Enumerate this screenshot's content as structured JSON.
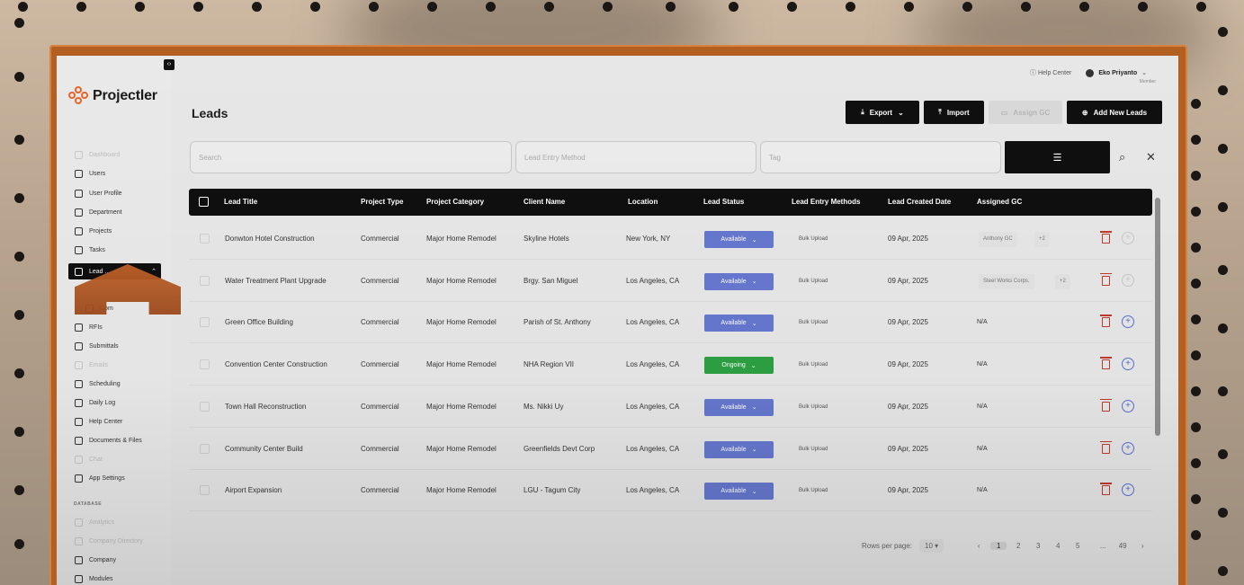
{
  "app": {
    "name": "Projectler"
  },
  "header": {
    "help": "Help Center",
    "user_name": "Eko Priyanto",
    "user_role": "Member"
  },
  "page": {
    "title": "Leads"
  },
  "actions": {
    "export": "Export",
    "import": "Import",
    "assign_gc": "Assign GC",
    "add_new": "Add New Leads"
  },
  "filters": {
    "search_placeholder": "Search",
    "entry_method_placeholder": "Lead Entry Method",
    "tag_placeholder": "Tag"
  },
  "sidebar": {
    "items": [
      {
        "label": "Dashboard",
        "icon": "dashboard-icon",
        "faded": true
      },
      {
        "label": "Users",
        "icon": "users-icon",
        "faded": false
      },
      {
        "label": "User Profile",
        "icon": "user-profile-icon",
        "faded": false
      },
      {
        "label": "Department",
        "icon": "department-icon",
        "faded": false
      },
      {
        "label": "Projects",
        "icon": "projects-icon",
        "faded": false
      },
      {
        "label": "Tasks",
        "icon": "tasks-icon",
        "faded": false
      },
      {
        "label": "Lead ...",
        "icon": "leads-icon",
        "active": true
      },
      {
        "label": "Com",
        "icon": "sub-icon",
        "faded": false
      },
      {
        "label": "RFIs",
        "icon": "rfis-icon",
        "faded": false
      },
      {
        "label": "Submittals",
        "icon": "submittals-icon",
        "faded": false
      },
      {
        "label": "Emails",
        "icon": "emails-icon",
        "faded": true
      },
      {
        "label": "Scheduling",
        "icon": "scheduling-icon",
        "faded": false
      },
      {
        "label": "Daily Log",
        "icon": "daily-log-icon",
        "faded": false
      },
      {
        "label": "Help Center",
        "icon": "help-icon",
        "faded": false
      },
      {
        "label": "Documents & Files",
        "icon": "documents-icon",
        "faded": false
      },
      {
        "label": "Chat",
        "icon": "chat-icon",
        "faded": true
      },
      {
        "label": "App Settings",
        "icon": "settings-icon",
        "faded": false
      }
    ],
    "section_label": "DATABASE",
    "database_items": [
      {
        "label": "Analytics",
        "faded": true
      },
      {
        "label": "Company Directory",
        "faded": true
      },
      {
        "label": "Company",
        "faded": false
      },
      {
        "label": "Modules",
        "faded": false
      }
    ]
  },
  "table": {
    "headers": [
      "Lead Title",
      "Project Type",
      "Project Category",
      "Client Name",
      "Location",
      "Lead Status",
      "Lead Entry Methods",
      "Lead Created Date",
      "Assigned GC"
    ],
    "rows": [
      {
        "title": "Donwton Hotel Construction",
        "type": "Commercial",
        "category": "Major Home Remodel",
        "client": "Skyline Hotels",
        "location": "New York, NY",
        "status": "Available",
        "entry": "Bulk Upload",
        "date": "09 Apr, 2025",
        "gc": "Anthony GC",
        "gc_more": "+2"
      },
      {
        "title": "Water Treatment Plant Upgrade",
        "type": "Commercial",
        "category": "Major Home Remodel",
        "client": "Brgy. San Miguel",
        "location": "Los Angeles, CA",
        "status": "Available",
        "entry": "Bulk Upload",
        "date": "09 Apr, 2025",
        "gc": "Steel Works Corps.",
        "gc_more": "+2"
      },
      {
        "title": "Green Office Building",
        "type": "Commercial",
        "category": "Major Home Remodel",
        "client": "Parish of St. Anthony",
        "location": "Los Angeles, CA",
        "status": "Available",
        "entry": "Bulk Upload",
        "date": "09 Apr, 2025",
        "gc": "N/A",
        "gc_more": ""
      },
      {
        "title": "Convention Center Construction",
        "type": "Commercial",
        "category": "Major Home Remodel",
        "client": "NHA Region VII",
        "location": "Los Angeles, CA",
        "status": "Ongoing",
        "entry": "Bulk Upload",
        "date": "09 Apr, 2025",
        "gc": "N/A",
        "gc_more": ""
      },
      {
        "title": "Town Hall Reconstruction",
        "type": "Commercial",
        "category": "Major Home Remodel",
        "client": "Ms. Nikki Uy",
        "location": "Los Angeles, CA",
        "status": "Available",
        "entry": "Bulk Upload",
        "date": "09 Apr, 2025",
        "gc": "N/A",
        "gc_more": ""
      },
      {
        "title": "Community Center Build",
        "type": "Commercial",
        "category": "Major Home Remodel",
        "client": "Greenfields Devt Corp",
        "location": "Los Angeles, CA",
        "status": "Available",
        "entry": "Bulk Upload",
        "date": "09 Apr, 2025",
        "gc": "N/A",
        "gc_more": ""
      },
      {
        "title": "Airport Expansion",
        "type": "Commercial",
        "category": "Major Home Remodel",
        "client": "LGU - Tagum City",
        "location": "Los Angeles, CA",
        "status": "Available",
        "entry": "Bulk Upload",
        "date": "09 Apr, 2025",
        "gc": "N/A",
        "gc_more": ""
      }
    ]
  },
  "pagination": {
    "rows_label": "Rows per page:",
    "rows_value": "10",
    "pages": [
      "1",
      "2",
      "3",
      "4",
      "5",
      "...",
      "49"
    ],
    "current": "1"
  },
  "colors": {
    "available": "#6678cf",
    "ongoing": "#2ea043",
    "brand": "#e8642b",
    "dark": "#0f0f0f"
  }
}
